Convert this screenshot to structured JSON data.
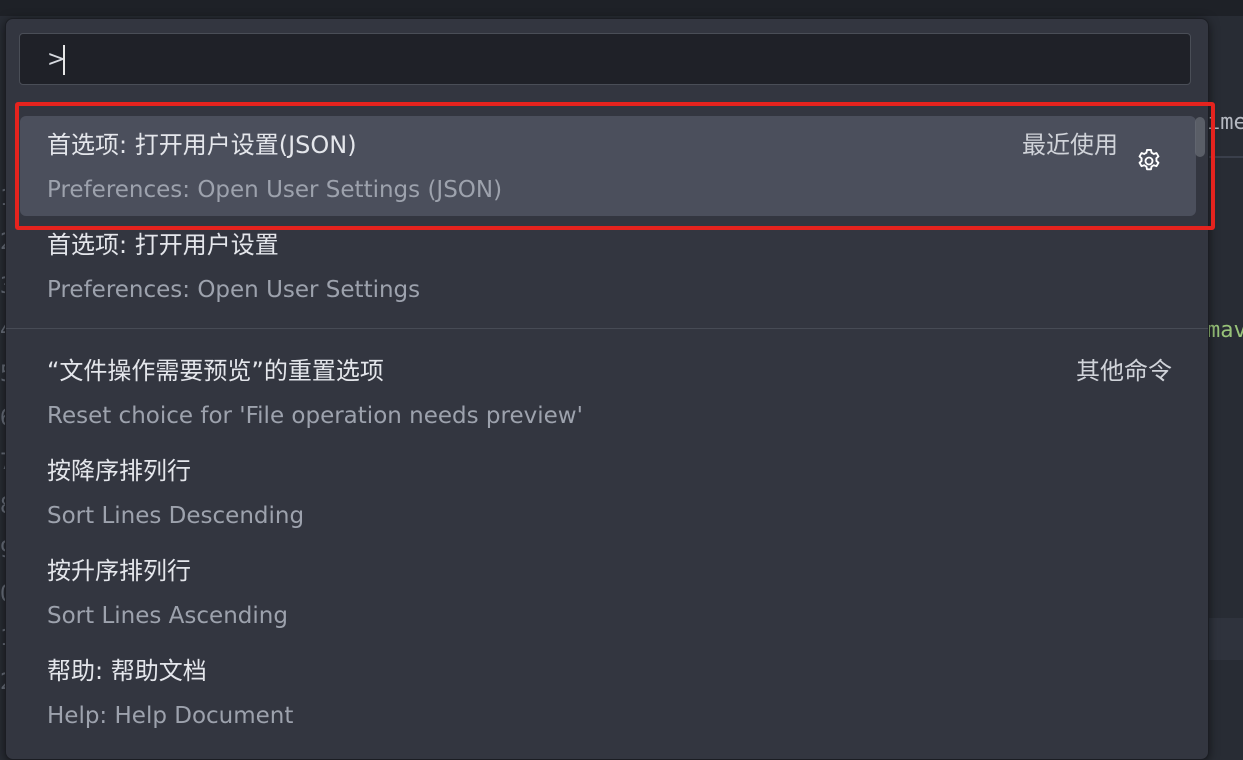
{
  "background": {
    "right_snippets": [
      {
        "text": "ime",
        "color": "#b4b8c0"
      },
      {
        "text": "mav",
        "color": "#98c379"
      }
    ]
  },
  "command_palette": {
    "input": {
      "value": ">"
    },
    "items": [
      {
        "label": "首选项: 打开用户设置(JSON)",
        "detail": "Preferences: Open User Settings (JSON)",
        "group": "最近使用",
        "selected": true,
        "icon": "gear-icon"
      },
      {
        "label": "首选项: 打开用户设置",
        "detail": "Preferences: Open User Settings",
        "group": "",
        "selected": false
      },
      {
        "label": "“文件操作需要预览”的重置选项",
        "detail": "Reset choice for 'File operation needs preview'",
        "group": "其他命令",
        "selected": false
      },
      {
        "label": "按降序排列行",
        "detail": "Sort Lines Descending",
        "group": "",
        "selected": false
      },
      {
        "label": "按升序排列行",
        "detail": "Sort Lines Ascending",
        "group": "",
        "selected": false
      },
      {
        "label": "帮助: 帮助文档",
        "detail": "Help: Help Document",
        "group": "",
        "selected": false
      }
    ]
  },
  "colors": {
    "palette_bg": "#333640",
    "selected_bg": "#4b4f5c",
    "annotation_red": "#e5231e"
  }
}
